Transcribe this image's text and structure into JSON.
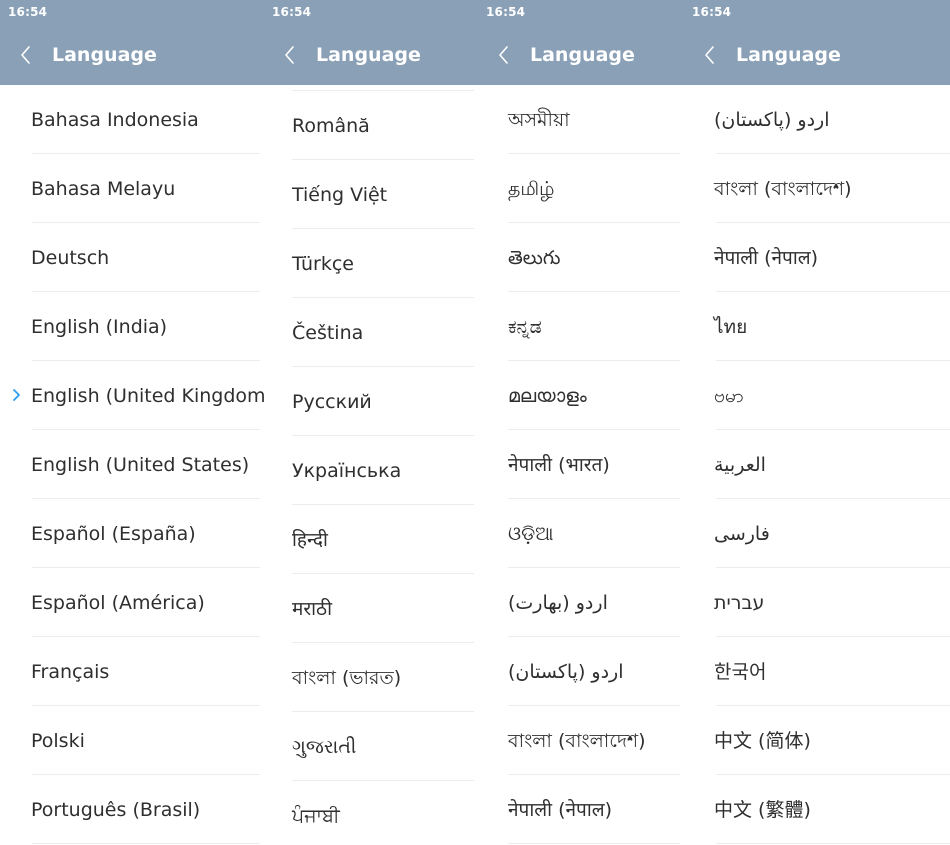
{
  "panels": [
    {
      "time": "16:54",
      "title": "Language",
      "items": [
        "Bahasa Indonesia",
        "Bahasa Melayu",
        "Deutsch",
        "English (India)",
        "English (United Kingdom)",
        "English (United States)",
        "Español (España)",
        "Español (América)",
        "Français",
        "Polski",
        "Português (Brasil)"
      ]
    },
    {
      "time": "16:54",
      "title": "Language",
      "items": [
        "Română",
        "Tiếng Việt",
        "Türkçe",
        "Čeština",
        "Русский",
        "Українська",
        "हिन्दी",
        "मराठी",
        "বাংলা (ভারত)",
        "ગુજરાતી",
        "ਪੰਜਾਬੀ"
      ]
    },
    {
      "time": "16:54",
      "title": "Language",
      "items": [
        "অসমীয়া",
        "தமிழ்",
        "తెలుగు",
        "ಕನ್ನಡ",
        "മലയാളം",
        "नेपाली (भारत)",
        "ଓଡ଼ିଆ",
        "اردو (بھارت)",
        "اردو (پاکستان)",
        "বাংলা (বাংলাদেশ)",
        "नेपाली (नेपाल)"
      ]
    },
    {
      "time": "16:54",
      "title": "Language",
      "items": [
        "اردو (پاکستان)",
        "বাংলা (বাংলাদেশ)",
        "नेपाली (नेपाल)",
        "ไทย",
        "ဗမာ",
        "العربية",
        "فارسی",
        "עברית",
        "한국어",
        "中文 (简体)",
        "中文 (繁體)"
      ]
    }
  ],
  "selected": {
    "panel": 0,
    "item": 4,
    "icon": "chevron-right-icon"
  },
  "colors": {
    "header": "#8aa0b7",
    "header_text": "#ffffff",
    "item_text": "#2f2f2f",
    "divider": "#ececec",
    "selected_indicator": "#2a9df4"
  }
}
